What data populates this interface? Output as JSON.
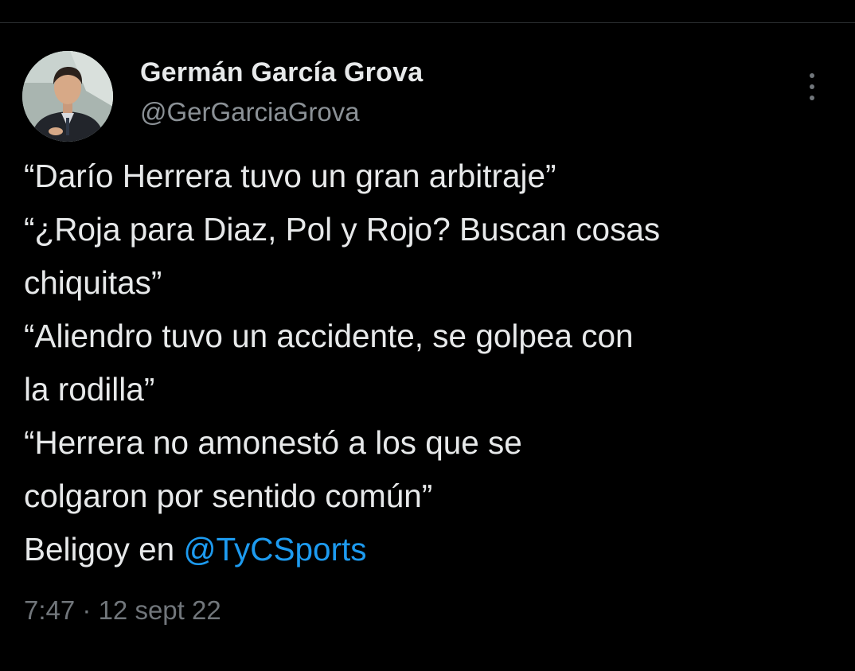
{
  "author": {
    "display_name": "Germán García Grova",
    "handle": "@GerGarciaGrova"
  },
  "tweet": {
    "lines": [
      "“Darío Herrera tuvo un gran arbitraje”",
      "“¿Roja para Diaz, Pol y Rojo? Buscan cosas",
      "chiquitas”",
      "“Aliendro tuvo un accidente, se golpea con",
      "la rodilla”",
      "“Herrera no amonestó a los que se",
      "colgaron por sentido común”"
    ],
    "last_line_prefix": "Beligoy en ",
    "mention": "@TyCSports",
    "time": "7:47",
    "separator": "·",
    "date": "12 sept 22"
  },
  "icons": {
    "more": "more-vertical-icon",
    "avatar": "profile-photo"
  },
  "colors": {
    "background": "#000000",
    "text_primary": "#e7e9ea",
    "text_secondary": "#71767b",
    "link": "#1d9bf0"
  }
}
